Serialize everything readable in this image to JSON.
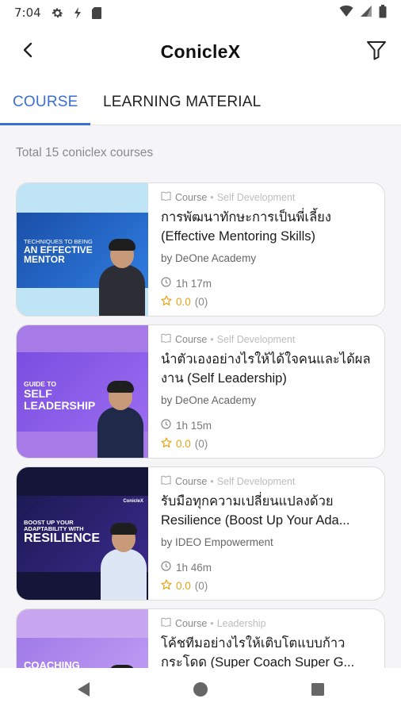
{
  "status_bar": {
    "time": "7:04",
    "icons": [
      "gear-icon",
      "data-saver-icon",
      "sd-card-icon",
      "wifi-icon",
      "cell-signal-icon",
      "battery-icon"
    ]
  },
  "app_bar": {
    "title": "ConicleX",
    "back_icon": "chevron-left-icon",
    "filter_icon": "filter-icon"
  },
  "tabs": [
    {
      "label": "COURSE",
      "active": true
    },
    {
      "label": "LEARNING MATERIAL",
      "active": false
    }
  ],
  "accent_color": "#3b6fd8",
  "total_label": "Total 15 coniclex courses",
  "courses": [
    {
      "type": "Course",
      "category": "Self Development",
      "title_line1": "การพัฒนาทักษะการเป็นพี่เลี้ยง",
      "title_line2": "(Effective Mentoring Skills)",
      "provider": "by DeOne Academy",
      "duration": "1h 17m",
      "rating": "0.0",
      "rating_count": "(0)",
      "thumb_text": "TECHNIQUES TO BEING AN EFFECTIVE MENTOR"
    },
    {
      "type": "Course",
      "category": "Self Development",
      "title_line1": "นำตัวเองอย่างไรให้ได้ใจคนและได้ผล",
      "title_line2": "งาน (Self Leadership)",
      "provider": "by DeOne Academy",
      "duration": "1h 15m",
      "rating": "0.0",
      "rating_count": "(0)",
      "thumb_text": "GUIDE TO SELF LEADERSHIP"
    },
    {
      "type": "Course",
      "category": "Self Development",
      "title_line1": "รับมือทุกความเปลี่ยนแปลงด้วย",
      "title_line2": "Resilience (Boost Up Your Ada...",
      "provider": "by IDEO Empowerment",
      "duration": "1h 46m",
      "rating": "0.0",
      "rating_count": "(0)",
      "thumb_text": "BOOST UP YOUR ADAPTABILITY WITH RESILIENCE",
      "thumb_logo": "ConicleX"
    },
    {
      "type": "Course",
      "category": "Leadership",
      "title_line1": "โค้ชทีมอย่างไรให้เติบโตแบบก้าว",
      "title_line2": "กระโดด (Super Coach Super G...",
      "provider": "",
      "duration": "",
      "rating": "",
      "rating_count": "",
      "thumb_text": "COACHING"
    }
  ],
  "nav_bar": [
    "back-triangle-icon",
    "home-circle-icon",
    "recents-square-icon"
  ]
}
